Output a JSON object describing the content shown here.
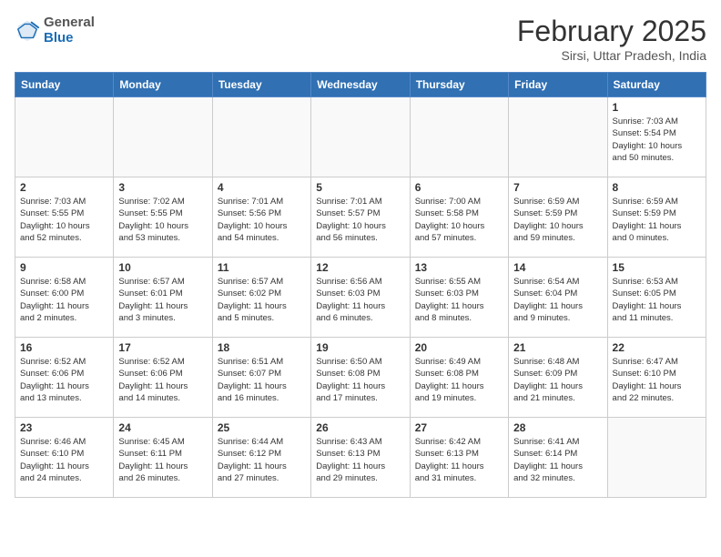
{
  "header": {
    "logo_general": "General",
    "logo_blue": "Blue",
    "month": "February 2025",
    "location": "Sirsi, Uttar Pradesh, India"
  },
  "weekdays": [
    "Sunday",
    "Monday",
    "Tuesday",
    "Wednesday",
    "Thursday",
    "Friday",
    "Saturday"
  ],
  "weeks": [
    [
      {
        "day": "",
        "info": ""
      },
      {
        "day": "",
        "info": ""
      },
      {
        "day": "",
        "info": ""
      },
      {
        "day": "",
        "info": ""
      },
      {
        "day": "",
        "info": ""
      },
      {
        "day": "",
        "info": ""
      },
      {
        "day": "1",
        "info": "Sunrise: 7:03 AM\nSunset: 5:54 PM\nDaylight: 10 hours\nand 50 minutes."
      }
    ],
    [
      {
        "day": "2",
        "info": "Sunrise: 7:03 AM\nSunset: 5:55 PM\nDaylight: 10 hours\nand 52 minutes."
      },
      {
        "day": "3",
        "info": "Sunrise: 7:02 AM\nSunset: 5:55 PM\nDaylight: 10 hours\nand 53 minutes."
      },
      {
        "day": "4",
        "info": "Sunrise: 7:01 AM\nSunset: 5:56 PM\nDaylight: 10 hours\nand 54 minutes."
      },
      {
        "day": "5",
        "info": "Sunrise: 7:01 AM\nSunset: 5:57 PM\nDaylight: 10 hours\nand 56 minutes."
      },
      {
        "day": "6",
        "info": "Sunrise: 7:00 AM\nSunset: 5:58 PM\nDaylight: 10 hours\nand 57 minutes."
      },
      {
        "day": "7",
        "info": "Sunrise: 6:59 AM\nSunset: 5:59 PM\nDaylight: 10 hours\nand 59 minutes."
      },
      {
        "day": "8",
        "info": "Sunrise: 6:59 AM\nSunset: 5:59 PM\nDaylight: 11 hours\nand 0 minutes."
      }
    ],
    [
      {
        "day": "9",
        "info": "Sunrise: 6:58 AM\nSunset: 6:00 PM\nDaylight: 11 hours\nand 2 minutes."
      },
      {
        "day": "10",
        "info": "Sunrise: 6:57 AM\nSunset: 6:01 PM\nDaylight: 11 hours\nand 3 minutes."
      },
      {
        "day": "11",
        "info": "Sunrise: 6:57 AM\nSunset: 6:02 PM\nDaylight: 11 hours\nand 5 minutes."
      },
      {
        "day": "12",
        "info": "Sunrise: 6:56 AM\nSunset: 6:03 PM\nDaylight: 11 hours\nand 6 minutes."
      },
      {
        "day": "13",
        "info": "Sunrise: 6:55 AM\nSunset: 6:03 PM\nDaylight: 11 hours\nand 8 minutes."
      },
      {
        "day": "14",
        "info": "Sunrise: 6:54 AM\nSunset: 6:04 PM\nDaylight: 11 hours\nand 9 minutes."
      },
      {
        "day": "15",
        "info": "Sunrise: 6:53 AM\nSunset: 6:05 PM\nDaylight: 11 hours\nand 11 minutes."
      }
    ],
    [
      {
        "day": "16",
        "info": "Sunrise: 6:52 AM\nSunset: 6:06 PM\nDaylight: 11 hours\nand 13 minutes."
      },
      {
        "day": "17",
        "info": "Sunrise: 6:52 AM\nSunset: 6:06 PM\nDaylight: 11 hours\nand 14 minutes."
      },
      {
        "day": "18",
        "info": "Sunrise: 6:51 AM\nSunset: 6:07 PM\nDaylight: 11 hours\nand 16 minutes."
      },
      {
        "day": "19",
        "info": "Sunrise: 6:50 AM\nSunset: 6:08 PM\nDaylight: 11 hours\nand 17 minutes."
      },
      {
        "day": "20",
        "info": "Sunrise: 6:49 AM\nSunset: 6:08 PM\nDaylight: 11 hours\nand 19 minutes."
      },
      {
        "day": "21",
        "info": "Sunrise: 6:48 AM\nSunset: 6:09 PM\nDaylight: 11 hours\nand 21 minutes."
      },
      {
        "day": "22",
        "info": "Sunrise: 6:47 AM\nSunset: 6:10 PM\nDaylight: 11 hours\nand 22 minutes."
      }
    ],
    [
      {
        "day": "23",
        "info": "Sunrise: 6:46 AM\nSunset: 6:10 PM\nDaylight: 11 hours\nand 24 minutes."
      },
      {
        "day": "24",
        "info": "Sunrise: 6:45 AM\nSunset: 6:11 PM\nDaylight: 11 hours\nand 26 minutes."
      },
      {
        "day": "25",
        "info": "Sunrise: 6:44 AM\nSunset: 6:12 PM\nDaylight: 11 hours\nand 27 minutes."
      },
      {
        "day": "26",
        "info": "Sunrise: 6:43 AM\nSunset: 6:13 PM\nDaylight: 11 hours\nand 29 minutes."
      },
      {
        "day": "27",
        "info": "Sunrise: 6:42 AM\nSunset: 6:13 PM\nDaylight: 11 hours\nand 31 minutes."
      },
      {
        "day": "28",
        "info": "Sunrise: 6:41 AM\nSunset: 6:14 PM\nDaylight: 11 hours\nand 32 minutes."
      },
      {
        "day": "",
        "info": ""
      }
    ]
  ]
}
